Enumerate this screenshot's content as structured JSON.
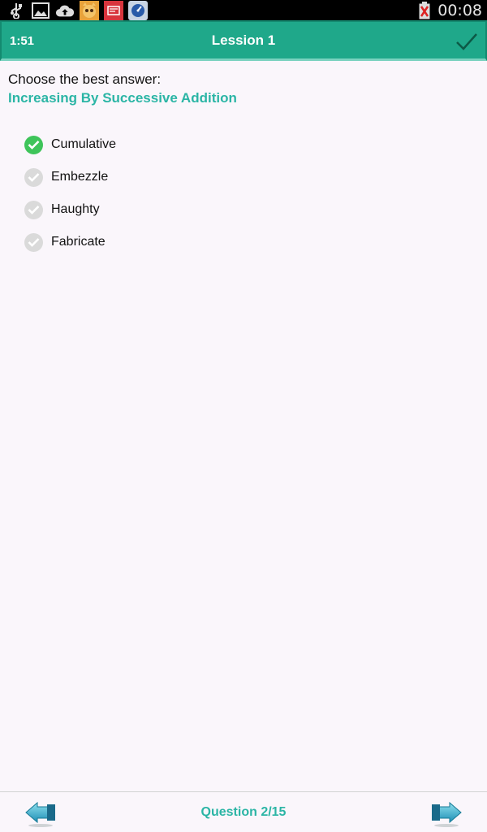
{
  "status_bar": {
    "time": "00:08",
    "icons": [
      "usb-icon",
      "image-icon",
      "cloud-upload-icon",
      "cat-app-icon",
      "red-app-icon",
      "speedometer-app-icon",
      "battery-icon"
    ]
  },
  "header": {
    "timer": "1:51",
    "title": "Lession 1"
  },
  "question": {
    "prompt": "Choose the best answer:",
    "term": "Increasing By Successive Addition"
  },
  "options": [
    {
      "label": "Cumulative",
      "selected": true
    },
    {
      "label": "Embezzle",
      "selected": false
    },
    {
      "label": "Haughty",
      "selected": false
    },
    {
      "label": "Fabricate",
      "selected": false
    }
  ],
  "footer": {
    "question_counter": "Question 2/15"
  },
  "colors": {
    "header_bg": "#1fa88a",
    "accent_text": "#2bb5a5",
    "selected_check": "#3ec45a",
    "unselected_check": "#dadada"
  }
}
